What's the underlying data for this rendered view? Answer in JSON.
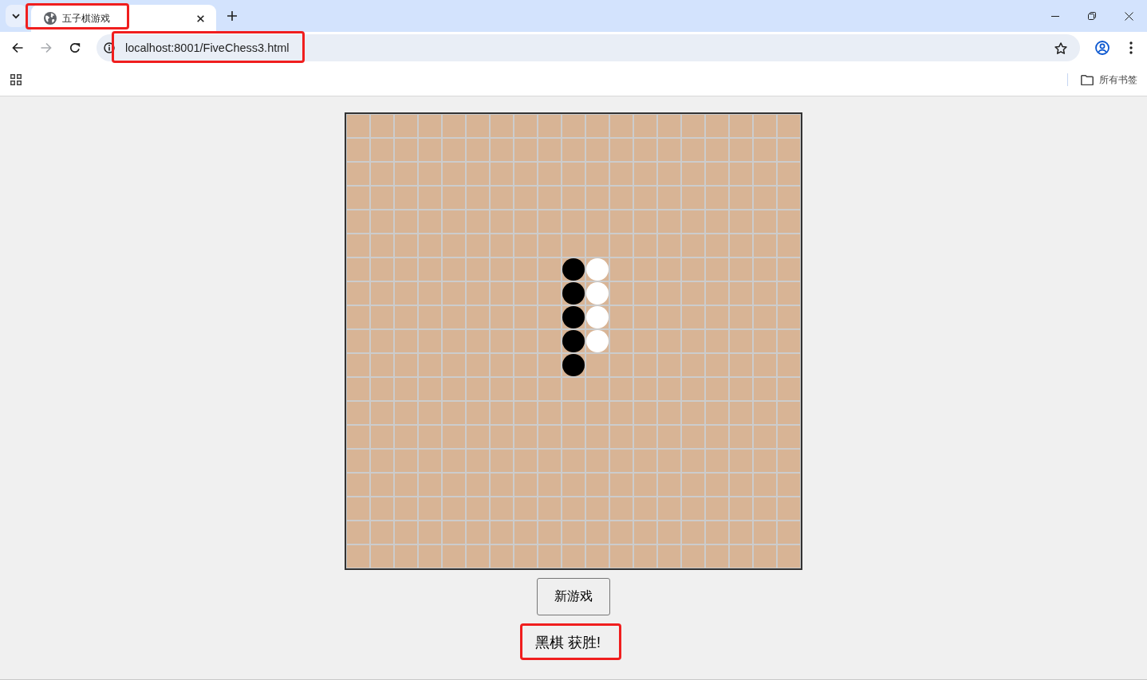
{
  "browser": {
    "tabs": [
      {
        "title": "五子棋游戏",
        "selected": true,
        "highlighted": true
      }
    ],
    "navigation": {
      "back_disabled": false,
      "forward_disabled": true
    },
    "address_bar": {
      "url": "localhost:8001/FiveChess3.html",
      "highlighted": true
    },
    "bookmarks_bar": {
      "folder": "所有书签"
    }
  },
  "board": {
    "rows": [
      [
        {
          "kind": "empty"
        },
        {
          "kind": "empty"
        },
        {
          "kind": "empty"
        },
        {
          "kind": "empty"
        },
        {
          "kind": "empty"
        },
        {
          "kind": "empty"
        },
        {
          "kind": "empty"
        },
        {
          "kind": "empty"
        },
        {
          "kind": "empty"
        },
        {
          "kind": "empty"
        },
        {
          "kind": "empty"
        },
        {
          "kind": "empty"
        },
        {
          "kind": "empty"
        },
        {
          "kind": "empty"
        },
        {
          "kind": "empty"
        },
        {
          "kind": "empty"
        },
        {
          "kind": "empty"
        },
        {
          "kind": "empty"
        },
        {
          "kind": "empty"
        }
      ],
      [
        {
          "kind": "empty"
        },
        {
          "kind": "empty"
        },
        {
          "kind": "empty"
        },
        {
          "kind": "empty"
        },
        {
          "kind": "empty"
        },
        {
          "kind": "empty"
        },
        {
          "kind": "empty"
        },
        {
          "kind": "empty"
        },
        {
          "kind": "empty"
        },
        {
          "kind": "empty"
        },
        {
          "kind": "empty"
        },
        {
          "kind": "empty"
        },
        {
          "kind": "empty"
        },
        {
          "kind": "empty"
        },
        {
          "kind": "empty"
        },
        {
          "kind": "empty"
        },
        {
          "kind": "empty"
        },
        {
          "kind": "empty"
        },
        {
          "kind": "empty"
        }
      ],
      [
        {
          "kind": "empty"
        },
        {
          "kind": "empty"
        },
        {
          "kind": "empty"
        },
        {
          "kind": "empty"
        },
        {
          "kind": "empty"
        },
        {
          "kind": "empty"
        },
        {
          "kind": "empty"
        },
        {
          "kind": "empty"
        },
        {
          "kind": "empty"
        },
        {
          "kind": "empty"
        },
        {
          "kind": "empty"
        },
        {
          "kind": "empty"
        },
        {
          "kind": "empty"
        },
        {
          "kind": "empty"
        },
        {
          "kind": "empty"
        },
        {
          "kind": "empty"
        },
        {
          "kind": "empty"
        },
        {
          "kind": "empty"
        },
        {
          "kind": "empty"
        }
      ],
      [
        {
          "kind": "empty"
        },
        {
          "kind": "empty"
        },
        {
          "kind": "empty"
        },
        {
          "kind": "empty"
        },
        {
          "kind": "empty"
        },
        {
          "kind": "empty"
        },
        {
          "kind": "empty"
        },
        {
          "kind": "empty"
        },
        {
          "kind": "empty"
        },
        {
          "kind": "empty"
        },
        {
          "kind": "empty"
        },
        {
          "kind": "empty"
        },
        {
          "kind": "empty"
        },
        {
          "kind": "empty"
        },
        {
          "kind": "empty"
        },
        {
          "kind": "empty"
        },
        {
          "kind": "empty"
        },
        {
          "kind": "empty"
        },
        {
          "kind": "empty"
        }
      ],
      [
        {
          "kind": "empty"
        },
        {
          "kind": "empty"
        },
        {
          "kind": "empty"
        },
        {
          "kind": "empty"
        },
        {
          "kind": "empty"
        },
        {
          "kind": "empty"
        },
        {
          "kind": "empty"
        },
        {
          "kind": "empty"
        },
        {
          "kind": "empty"
        },
        {
          "kind": "empty"
        },
        {
          "kind": "empty"
        },
        {
          "kind": "empty"
        },
        {
          "kind": "empty"
        },
        {
          "kind": "empty"
        },
        {
          "kind": "empty"
        },
        {
          "kind": "empty"
        },
        {
          "kind": "empty"
        },
        {
          "kind": "empty"
        },
        {
          "kind": "empty"
        }
      ],
      [
        {
          "kind": "empty"
        },
        {
          "kind": "empty"
        },
        {
          "kind": "empty"
        },
        {
          "kind": "empty"
        },
        {
          "kind": "empty"
        },
        {
          "kind": "empty"
        },
        {
          "kind": "empty"
        },
        {
          "kind": "empty"
        },
        {
          "kind": "empty"
        },
        {
          "kind": "empty"
        },
        {
          "kind": "empty"
        },
        {
          "kind": "empty"
        },
        {
          "kind": "empty"
        },
        {
          "kind": "empty"
        },
        {
          "kind": "empty"
        },
        {
          "kind": "empty"
        },
        {
          "kind": "empty"
        },
        {
          "kind": "empty"
        },
        {
          "kind": "empty"
        }
      ],
      [
        {
          "kind": "empty"
        },
        {
          "kind": "empty"
        },
        {
          "kind": "empty"
        },
        {
          "kind": "empty"
        },
        {
          "kind": "empty"
        },
        {
          "kind": "empty"
        },
        {
          "kind": "empty"
        },
        {
          "kind": "empty"
        },
        {
          "kind": "empty"
        },
        {
          "kind": "black"
        },
        {
          "kind": "white"
        },
        {
          "kind": "empty"
        },
        {
          "kind": "empty"
        },
        {
          "kind": "empty"
        },
        {
          "kind": "empty"
        },
        {
          "kind": "empty"
        },
        {
          "kind": "empty"
        },
        {
          "kind": "empty"
        },
        {
          "kind": "empty"
        }
      ],
      [
        {
          "kind": "empty"
        },
        {
          "kind": "empty"
        },
        {
          "kind": "empty"
        },
        {
          "kind": "empty"
        },
        {
          "kind": "empty"
        },
        {
          "kind": "empty"
        },
        {
          "kind": "empty"
        },
        {
          "kind": "empty"
        },
        {
          "kind": "empty"
        },
        {
          "kind": "black"
        },
        {
          "kind": "white"
        },
        {
          "kind": "empty"
        },
        {
          "kind": "empty"
        },
        {
          "kind": "empty"
        },
        {
          "kind": "empty"
        },
        {
          "kind": "empty"
        },
        {
          "kind": "empty"
        },
        {
          "kind": "empty"
        },
        {
          "kind": "empty"
        }
      ],
      [
        {
          "kind": "empty"
        },
        {
          "kind": "empty"
        },
        {
          "kind": "empty"
        },
        {
          "kind": "empty"
        },
        {
          "kind": "empty"
        },
        {
          "kind": "empty"
        },
        {
          "kind": "empty"
        },
        {
          "kind": "empty"
        },
        {
          "kind": "empty"
        },
        {
          "kind": "black"
        },
        {
          "kind": "white"
        },
        {
          "kind": "empty"
        },
        {
          "kind": "empty"
        },
        {
          "kind": "empty"
        },
        {
          "kind": "empty"
        },
        {
          "kind": "empty"
        },
        {
          "kind": "empty"
        },
        {
          "kind": "empty"
        },
        {
          "kind": "empty"
        }
      ],
      [
        {
          "kind": "empty"
        },
        {
          "kind": "empty"
        },
        {
          "kind": "empty"
        },
        {
          "kind": "empty"
        },
        {
          "kind": "empty"
        },
        {
          "kind": "empty"
        },
        {
          "kind": "empty"
        },
        {
          "kind": "empty"
        },
        {
          "kind": "empty"
        },
        {
          "kind": "black"
        },
        {
          "kind": "white"
        },
        {
          "kind": "empty"
        },
        {
          "kind": "empty"
        },
        {
          "kind": "empty"
        },
        {
          "kind": "empty"
        },
        {
          "kind": "empty"
        },
        {
          "kind": "empty"
        },
        {
          "kind": "empty"
        },
        {
          "kind": "empty"
        }
      ],
      [
        {
          "kind": "empty"
        },
        {
          "kind": "empty"
        },
        {
          "kind": "empty"
        },
        {
          "kind": "empty"
        },
        {
          "kind": "empty"
        },
        {
          "kind": "empty"
        },
        {
          "kind": "empty"
        },
        {
          "kind": "empty"
        },
        {
          "kind": "empty"
        },
        {
          "kind": "black"
        },
        {
          "kind": "empty"
        },
        {
          "kind": "empty"
        },
        {
          "kind": "empty"
        },
        {
          "kind": "empty"
        },
        {
          "kind": "empty"
        },
        {
          "kind": "empty"
        },
        {
          "kind": "empty"
        },
        {
          "kind": "empty"
        },
        {
          "kind": "empty"
        }
      ],
      [
        {
          "kind": "empty"
        },
        {
          "kind": "empty"
        },
        {
          "kind": "empty"
        },
        {
          "kind": "empty"
        },
        {
          "kind": "empty"
        },
        {
          "kind": "empty"
        },
        {
          "kind": "empty"
        },
        {
          "kind": "empty"
        },
        {
          "kind": "empty"
        },
        {
          "kind": "empty"
        },
        {
          "kind": "empty"
        },
        {
          "kind": "empty"
        },
        {
          "kind": "empty"
        },
        {
          "kind": "empty"
        },
        {
          "kind": "empty"
        },
        {
          "kind": "empty"
        },
        {
          "kind": "empty"
        },
        {
          "kind": "empty"
        },
        {
          "kind": "empty"
        }
      ],
      [
        {
          "kind": "empty"
        },
        {
          "kind": "empty"
        },
        {
          "kind": "empty"
        },
        {
          "kind": "empty"
        },
        {
          "kind": "empty"
        },
        {
          "kind": "empty"
        },
        {
          "kind": "empty"
        },
        {
          "kind": "empty"
        },
        {
          "kind": "empty"
        },
        {
          "kind": "empty"
        },
        {
          "kind": "empty"
        },
        {
          "kind": "empty"
        },
        {
          "kind": "empty"
        },
        {
          "kind": "empty"
        },
        {
          "kind": "empty"
        },
        {
          "kind": "empty"
        },
        {
          "kind": "empty"
        },
        {
          "kind": "empty"
        },
        {
          "kind": "empty"
        }
      ],
      [
        {
          "kind": "empty"
        },
        {
          "kind": "empty"
        },
        {
          "kind": "empty"
        },
        {
          "kind": "empty"
        },
        {
          "kind": "empty"
        },
        {
          "kind": "empty"
        },
        {
          "kind": "empty"
        },
        {
          "kind": "empty"
        },
        {
          "kind": "empty"
        },
        {
          "kind": "empty"
        },
        {
          "kind": "empty"
        },
        {
          "kind": "empty"
        },
        {
          "kind": "empty"
        },
        {
          "kind": "empty"
        },
        {
          "kind": "empty"
        },
        {
          "kind": "empty"
        },
        {
          "kind": "empty"
        },
        {
          "kind": "empty"
        },
        {
          "kind": "empty"
        }
      ],
      [
        {
          "kind": "empty"
        },
        {
          "kind": "empty"
        },
        {
          "kind": "empty"
        },
        {
          "kind": "empty"
        },
        {
          "kind": "empty"
        },
        {
          "kind": "empty"
        },
        {
          "kind": "empty"
        },
        {
          "kind": "empty"
        },
        {
          "kind": "empty"
        },
        {
          "kind": "empty"
        },
        {
          "kind": "empty"
        },
        {
          "kind": "empty"
        },
        {
          "kind": "empty"
        },
        {
          "kind": "empty"
        },
        {
          "kind": "empty"
        },
        {
          "kind": "empty"
        },
        {
          "kind": "empty"
        },
        {
          "kind": "empty"
        },
        {
          "kind": "empty"
        }
      ],
      [
        {
          "kind": "empty"
        },
        {
          "kind": "empty"
        },
        {
          "kind": "empty"
        },
        {
          "kind": "empty"
        },
        {
          "kind": "empty"
        },
        {
          "kind": "empty"
        },
        {
          "kind": "empty"
        },
        {
          "kind": "empty"
        },
        {
          "kind": "empty"
        },
        {
          "kind": "empty"
        },
        {
          "kind": "empty"
        },
        {
          "kind": "empty"
        },
        {
          "kind": "empty"
        },
        {
          "kind": "empty"
        },
        {
          "kind": "empty"
        },
        {
          "kind": "empty"
        },
        {
          "kind": "empty"
        },
        {
          "kind": "empty"
        },
        {
          "kind": "empty"
        }
      ],
      [
        {
          "kind": "empty"
        },
        {
          "kind": "empty"
        },
        {
          "kind": "empty"
        },
        {
          "kind": "empty"
        },
        {
          "kind": "empty"
        },
        {
          "kind": "empty"
        },
        {
          "kind": "empty"
        },
        {
          "kind": "empty"
        },
        {
          "kind": "empty"
        },
        {
          "kind": "empty"
        },
        {
          "kind": "empty"
        },
        {
          "kind": "empty"
        },
        {
          "kind": "empty"
        },
        {
          "kind": "empty"
        },
        {
          "kind": "empty"
        },
        {
          "kind": "empty"
        },
        {
          "kind": "empty"
        },
        {
          "kind": "empty"
        },
        {
          "kind": "empty"
        }
      ],
      [
        {
          "kind": "empty"
        },
        {
          "kind": "empty"
        },
        {
          "kind": "empty"
        },
        {
          "kind": "empty"
        },
        {
          "kind": "empty"
        },
        {
          "kind": "empty"
        },
        {
          "kind": "empty"
        },
        {
          "kind": "empty"
        },
        {
          "kind": "empty"
        },
        {
          "kind": "empty"
        },
        {
          "kind": "empty"
        },
        {
          "kind": "empty"
        },
        {
          "kind": "empty"
        },
        {
          "kind": "empty"
        },
        {
          "kind": "empty"
        },
        {
          "kind": "empty"
        },
        {
          "kind": "empty"
        },
        {
          "kind": "empty"
        },
        {
          "kind": "empty"
        }
      ],
      [
        {
          "kind": "empty"
        },
        {
          "kind": "empty"
        },
        {
          "kind": "empty"
        },
        {
          "kind": "empty"
        },
        {
          "kind": "empty"
        },
        {
          "kind": "empty"
        },
        {
          "kind": "empty"
        },
        {
          "kind": "empty"
        },
        {
          "kind": "empty"
        },
        {
          "kind": "empty"
        },
        {
          "kind": "empty"
        },
        {
          "kind": "empty"
        },
        {
          "kind": "empty"
        },
        {
          "kind": "empty"
        },
        {
          "kind": "empty"
        },
        {
          "kind": "empty"
        },
        {
          "kind": "empty"
        },
        {
          "kind": "empty"
        },
        {
          "kind": "empty"
        }
      ]
    ]
  },
  "new_game_button": {
    "label": "新游戏"
  },
  "status": {
    "text": "黑棋 获胜!",
    "highlighted": true
  }
}
